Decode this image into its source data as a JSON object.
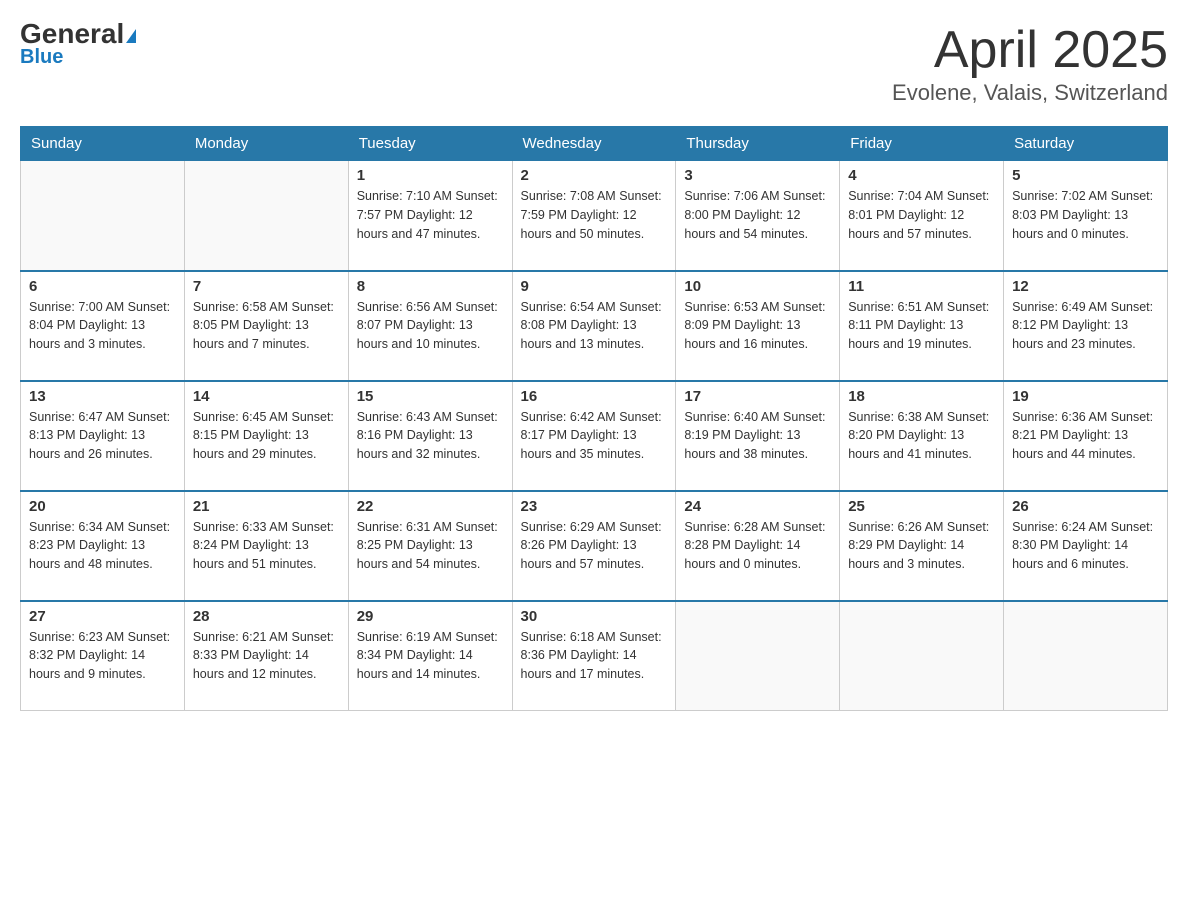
{
  "header": {
    "logo_general": "General",
    "logo_blue": "Blue",
    "month_title": "April 2025",
    "location": "Evolene, Valais, Switzerland"
  },
  "days_of_week": [
    "Sunday",
    "Monday",
    "Tuesday",
    "Wednesday",
    "Thursday",
    "Friday",
    "Saturday"
  ],
  "weeks": [
    [
      {
        "day": "",
        "info": ""
      },
      {
        "day": "",
        "info": ""
      },
      {
        "day": "1",
        "info": "Sunrise: 7:10 AM\nSunset: 7:57 PM\nDaylight: 12 hours\nand 47 minutes."
      },
      {
        "day": "2",
        "info": "Sunrise: 7:08 AM\nSunset: 7:59 PM\nDaylight: 12 hours\nand 50 minutes."
      },
      {
        "day": "3",
        "info": "Sunrise: 7:06 AM\nSunset: 8:00 PM\nDaylight: 12 hours\nand 54 minutes."
      },
      {
        "day": "4",
        "info": "Sunrise: 7:04 AM\nSunset: 8:01 PM\nDaylight: 12 hours\nand 57 minutes."
      },
      {
        "day": "5",
        "info": "Sunrise: 7:02 AM\nSunset: 8:03 PM\nDaylight: 13 hours\nand 0 minutes."
      }
    ],
    [
      {
        "day": "6",
        "info": "Sunrise: 7:00 AM\nSunset: 8:04 PM\nDaylight: 13 hours\nand 3 minutes."
      },
      {
        "day": "7",
        "info": "Sunrise: 6:58 AM\nSunset: 8:05 PM\nDaylight: 13 hours\nand 7 minutes."
      },
      {
        "day": "8",
        "info": "Sunrise: 6:56 AM\nSunset: 8:07 PM\nDaylight: 13 hours\nand 10 minutes."
      },
      {
        "day": "9",
        "info": "Sunrise: 6:54 AM\nSunset: 8:08 PM\nDaylight: 13 hours\nand 13 minutes."
      },
      {
        "day": "10",
        "info": "Sunrise: 6:53 AM\nSunset: 8:09 PM\nDaylight: 13 hours\nand 16 minutes."
      },
      {
        "day": "11",
        "info": "Sunrise: 6:51 AM\nSunset: 8:11 PM\nDaylight: 13 hours\nand 19 minutes."
      },
      {
        "day": "12",
        "info": "Sunrise: 6:49 AM\nSunset: 8:12 PM\nDaylight: 13 hours\nand 23 minutes."
      }
    ],
    [
      {
        "day": "13",
        "info": "Sunrise: 6:47 AM\nSunset: 8:13 PM\nDaylight: 13 hours\nand 26 minutes."
      },
      {
        "day": "14",
        "info": "Sunrise: 6:45 AM\nSunset: 8:15 PM\nDaylight: 13 hours\nand 29 minutes."
      },
      {
        "day": "15",
        "info": "Sunrise: 6:43 AM\nSunset: 8:16 PM\nDaylight: 13 hours\nand 32 minutes."
      },
      {
        "day": "16",
        "info": "Sunrise: 6:42 AM\nSunset: 8:17 PM\nDaylight: 13 hours\nand 35 minutes."
      },
      {
        "day": "17",
        "info": "Sunrise: 6:40 AM\nSunset: 8:19 PM\nDaylight: 13 hours\nand 38 minutes."
      },
      {
        "day": "18",
        "info": "Sunrise: 6:38 AM\nSunset: 8:20 PM\nDaylight: 13 hours\nand 41 minutes."
      },
      {
        "day": "19",
        "info": "Sunrise: 6:36 AM\nSunset: 8:21 PM\nDaylight: 13 hours\nand 44 minutes."
      }
    ],
    [
      {
        "day": "20",
        "info": "Sunrise: 6:34 AM\nSunset: 8:23 PM\nDaylight: 13 hours\nand 48 minutes."
      },
      {
        "day": "21",
        "info": "Sunrise: 6:33 AM\nSunset: 8:24 PM\nDaylight: 13 hours\nand 51 minutes."
      },
      {
        "day": "22",
        "info": "Sunrise: 6:31 AM\nSunset: 8:25 PM\nDaylight: 13 hours\nand 54 minutes."
      },
      {
        "day": "23",
        "info": "Sunrise: 6:29 AM\nSunset: 8:26 PM\nDaylight: 13 hours\nand 57 minutes."
      },
      {
        "day": "24",
        "info": "Sunrise: 6:28 AM\nSunset: 8:28 PM\nDaylight: 14 hours\nand 0 minutes."
      },
      {
        "day": "25",
        "info": "Sunrise: 6:26 AM\nSunset: 8:29 PM\nDaylight: 14 hours\nand 3 minutes."
      },
      {
        "day": "26",
        "info": "Sunrise: 6:24 AM\nSunset: 8:30 PM\nDaylight: 14 hours\nand 6 minutes."
      }
    ],
    [
      {
        "day": "27",
        "info": "Sunrise: 6:23 AM\nSunset: 8:32 PM\nDaylight: 14 hours\nand 9 minutes."
      },
      {
        "day": "28",
        "info": "Sunrise: 6:21 AM\nSunset: 8:33 PM\nDaylight: 14 hours\nand 12 minutes."
      },
      {
        "day": "29",
        "info": "Sunrise: 6:19 AM\nSunset: 8:34 PM\nDaylight: 14 hours\nand 14 minutes."
      },
      {
        "day": "30",
        "info": "Sunrise: 6:18 AM\nSunset: 8:36 PM\nDaylight: 14 hours\nand 17 minutes."
      },
      {
        "day": "",
        "info": ""
      },
      {
        "day": "",
        "info": ""
      },
      {
        "day": "",
        "info": ""
      }
    ]
  ]
}
